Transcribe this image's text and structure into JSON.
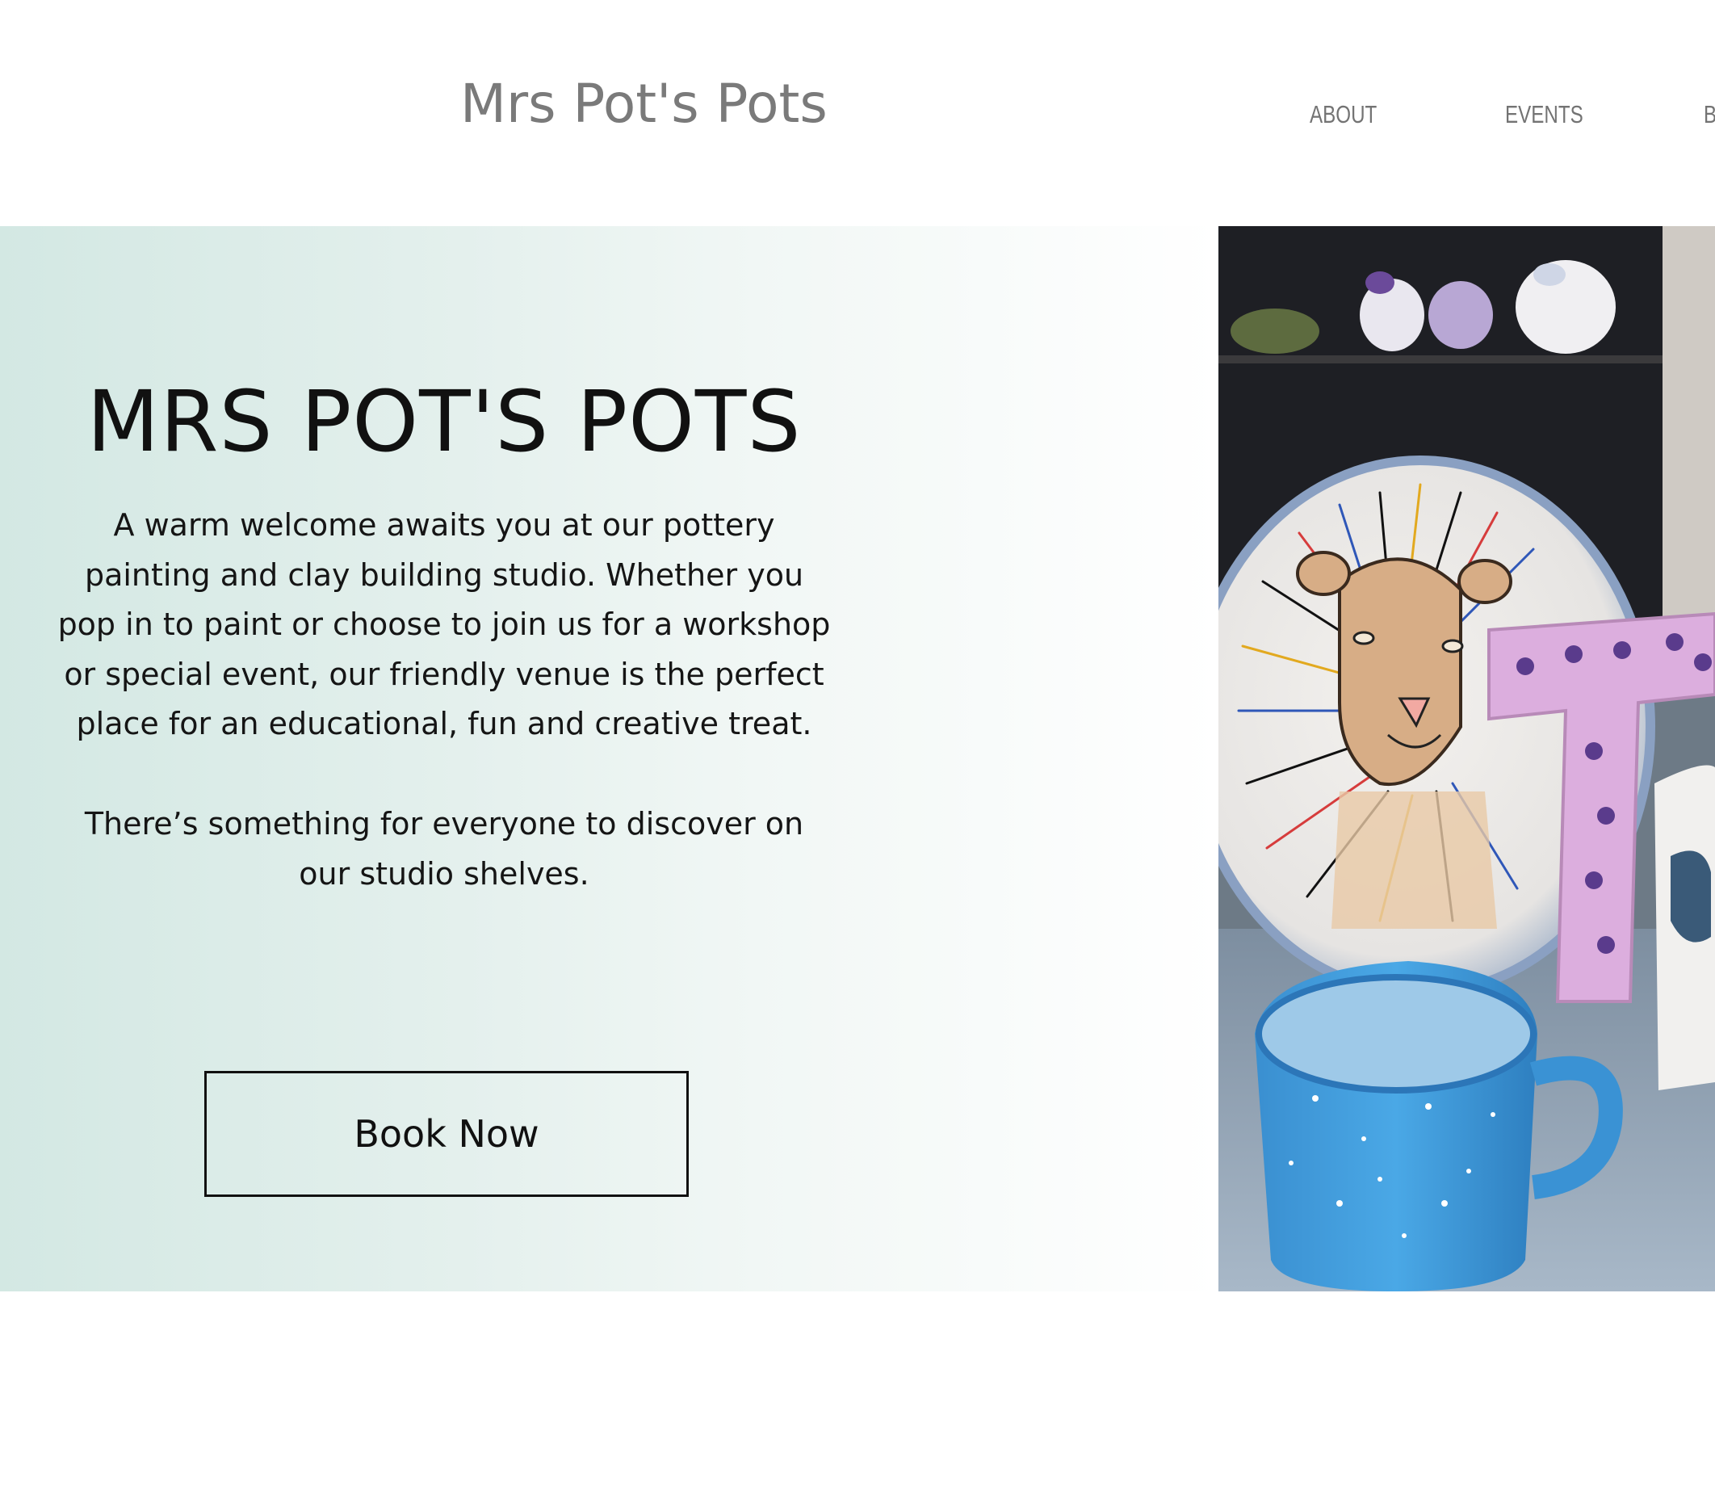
{
  "header": {
    "site_title": "Mrs Pot's Pots",
    "nav": {
      "about": "ABOUT",
      "events": "EVENTS",
      "clipped": "B"
    }
  },
  "hero": {
    "title": "MRS POT'S POTS",
    "paragraph_1": "A warm welcome awaits you at our pottery painting and clay building studio. Whether you pop in to paint or choose to join us for a workshop or special event, our friendly venue is the perfect place for an educational, fun and creative treat.",
    "paragraph_2": "There’s something for everyone to discover on our studio shelves.",
    "cta_label": "Book Now"
  },
  "colors": {
    "panel_gradient_start": "#d3e8e3",
    "panel_gradient_end": "#ffffff",
    "logo_text": "#7a7a7a",
    "nav_text": "#737373",
    "body_text": "#151515"
  }
}
